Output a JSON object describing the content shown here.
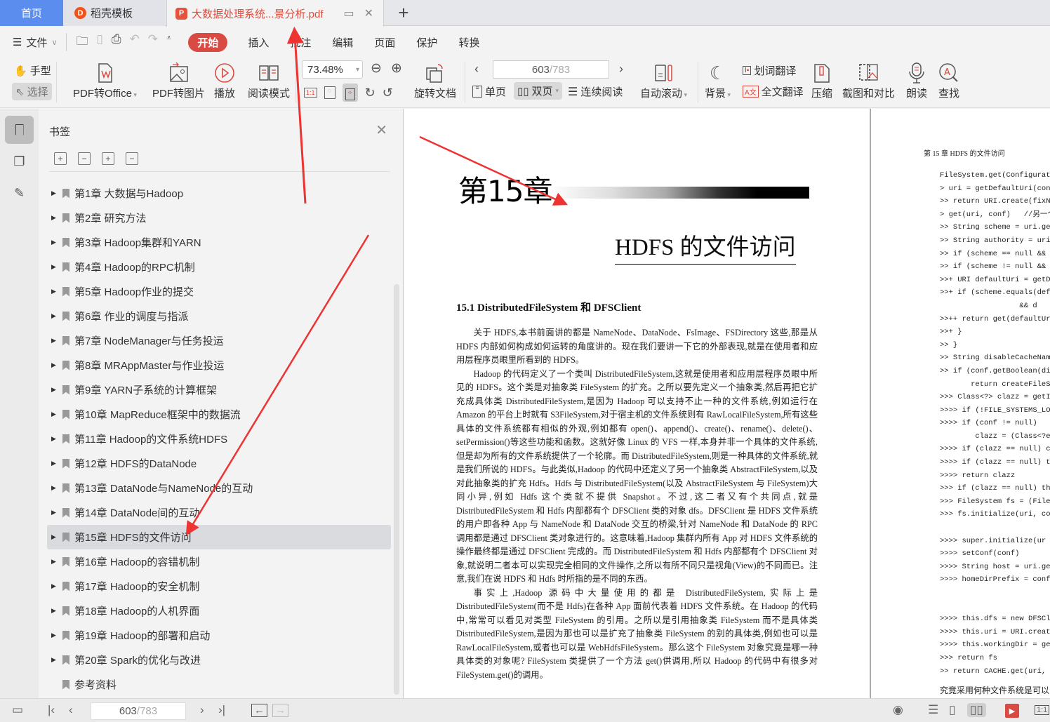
{
  "tabs": {
    "home": "首页",
    "template": "稻壳模板",
    "document": "大数据处理系统...景分析.pdf",
    "add": "+"
  },
  "menu": {
    "file": "文件",
    "items": [
      "开始",
      "插入",
      "批注",
      "编辑",
      "页面",
      "保护",
      "转换"
    ]
  },
  "toolbar": {
    "hand": "手型",
    "select": "选择",
    "pdf_to_office": "PDF转Office",
    "pdf_to_image": "PDF转图片",
    "play": "播放",
    "read_mode": "阅读模式",
    "zoom": "73.48%",
    "rotate_doc": "旋转文档",
    "page_current": "603",
    "page_total": "/783",
    "single": "单页",
    "double": "双页",
    "continuous": "连续阅读",
    "auto_scroll": "自动滚动",
    "background": "背景",
    "word_translate": "划词翻译",
    "full_translate": "全文翻译",
    "compress": "压缩",
    "screenshot_compare": "截图和对比",
    "read_aloud": "朗读",
    "find": "查找"
  },
  "bookmarks": {
    "title": "书签",
    "items": [
      {
        "label": "第1章  大数据与Hadoop",
        "expandable": true
      },
      {
        "label": "第2章  研究方法",
        "expandable": true
      },
      {
        "label": "第3章  Hadoop集群和YARN",
        "expandable": true
      },
      {
        "label": "第4章  Hadoop的RPC机制",
        "expandable": true
      },
      {
        "label": "第5章  Hadoop作业的提交",
        "expandable": true
      },
      {
        "label": "第6章  作业的调度与指派",
        "expandable": true
      },
      {
        "label": "第7章  NodeManager与任务投运",
        "expandable": true
      },
      {
        "label": "第8章  MRAppMaster与作业投运",
        "expandable": true
      },
      {
        "label": "第9章  YARN子系统的计算框架",
        "expandable": true
      },
      {
        "label": "第10章  MapReduce框架中的数据流",
        "expandable": true
      },
      {
        "label": "第11章  Hadoop的文件系统HDFS",
        "expandable": true
      },
      {
        "label": "第12章  HDFS的DataNode",
        "expandable": true
      },
      {
        "label": "第13章  DataNode与NameNode的互动",
        "expandable": true
      },
      {
        "label": "第14章  DataNode间的互动",
        "expandable": true
      },
      {
        "label": "第15章  HDFS的文件访问",
        "expandable": true,
        "active": true
      },
      {
        "label": "第16章  Hadoop的容错机制",
        "expandable": true
      },
      {
        "label": "第17章  Hadoop的安全机制",
        "expandable": true
      },
      {
        "label": "第18章  Hadoop的人机界面",
        "expandable": true
      },
      {
        "label": "第19章  Hadoop的部署和启动",
        "expandable": true
      },
      {
        "label": "第20章  Spark的优化与改进",
        "expandable": true
      },
      {
        "label": "参考资料",
        "expandable": false
      }
    ]
  },
  "page_left": {
    "chapter": "第15章",
    "title": "HDFS 的文件访问",
    "section": "15.1    DistributedFileSystem 和 DFSClient",
    "paragraphs": [
      "关于 HDFS,本书前面讲的都是 NameNode、DataNode、FsImage、FSDirectory 这些,那是从 HDFS 内部如何构成如何运转的角度讲的。现在我们要讲一下它的外部表现,就是在使用者和应用层程序员眼里所看到的 HDFS。",
      "Hadoop 的代码定义了一个类叫 DistributedFileSystem,这就是使用者和应用层程序员眼中所见的 HDFS。这个类是对抽象类 FileSystem 的扩充。之所以要先定义一个抽象类,然后再把它扩充成具体类 DistributedFileSystem,是因为 Hadoop 可以支持不止一种的文件系统,例如运行在 Amazon 的平台上时就有 S3FileSystem,对于宿主机的文件系统则有 RawLocalFileSystem,所有这些具体的文件系统都有相似的外观,例如都有 open()、append()、create()、rename()、delete()、setPermission()等这些功能和函数。这就好像 Linux 的 VFS 一样,本身并非一个具体的文件系统,但是却为所有的文件系统提供了一个轮廓。而 DistributedFileSystem,则是一种具体的文件系统,就是我们所说的 HDFS。与此类似,Hadoop 的代码中还定义了另一个抽象类 AbstractFileSystem,以及对此抽象类的扩充 Hdfs。Hdfs 与 DistributedFileSystem(以及 AbstractFileSystem 与 FileSystem)大同小异,例如 Hdfs 这个类就不提供 Snapshot。不过,这二者又有个共同点,就是 DistributedFileSystem 和 Hdfs 内部都有个 DFSClient 类的对象 dfs。DFSClient 是 HDFS 文件系统的用户即各种 App 与 NameNode 和 DataNode 交互的桥梁,针对 NameNode 和 DataNode 的 RPC 调用都是通过 DFSClient 类对象进行的。这意味着,Hadoop 集群内所有 App 对 HDFS 文件系统的操作最终都是通过 DFSClient 完成的。而 DistributedFileSystem 和 Hdfs 内部都有个 DFSClient 对象,就说明二者本可以实现完全相同的文件操作,之所以有所不同只是视角(View)的不同而已。注意,我们在说 HDFS 和 Hdfs 时所指的是不同的东西。",
      "事实上,Hadoop 源码中大量使用的都是 DistributedFileSystem,实际上是 DistributedFileSystem(而不是 Hdfs)在各种 App 面前代表着 HDFS 文件系统。在 Hadoop 的代码中,常常可以看见对类型 FileSystem 的引用。之所以是引用抽象类 FileSystem 而不是具体类 DistributedFileSystem,是因为那也可以是扩充了抽象类 FileSystem 的别的具体类,例如也可以是 RawLocalFileSystem,或者也可以是 WebHdfsFileSystem。那么这个 FileSystem 对象究竟是哪一种具体类的对象呢? FileSystem 类提供了一个方法 get()供调用,所以 Hadoop 的代码中有很多对 FileSystem.get()的调用。"
    ]
  },
  "page_right": {
    "header": "第 15 章    HDFS 的文件访问",
    "code_lines": [
      "FileSystem.get(Configuration",
      "> uri = getDefaultUri(conf)",
      ">> return URI.create(fixNa",
      "> get(uri, conf)   //另一个",
      ">> String scheme = uri.getS",
      ">> String authority = uri.g",
      ">> if (scheme == null && au",
      ">> if (scheme != null && aut",
      ">>+ URI defaultUri = getDe",
      ">>+ if (scheme.equals(def",
      "                  && d",
      ">>++ return get(defaultUr",
      ">>+ }",
      ">> }",
      ">> String disableCacheName",
      ">> if (conf.getBoolean(dis",
      "       return createFileSy",
      ">>> Class<?> clazz = getI",
      ">>>> if (!FILE_SYSTEMS_LO",
      ">>>> if (conf != null)",
      "        clazz = (Class<?ex",
      ">>>> if (clazz == null) cl",
      ">>>> if (clazz == null) th",
      ">>>> return clazz",
      ">>> if (clazz == null) throw",
      ">>> FileSystem fs = (FileSys",
      ">>> fs.initialize(uri, co",
      "",
      ">>>> super.initialize(ur",
      ">>>> setConf(conf)",
      ">>>> String host = uri.get",
      ">>>> homeDirPrefix = conf",
      "",
      "",
      ">>>> this.dfs = new DFSCl",
      ">>>> this.uri = URI.creat",
      ">>>> this.workingDir = ge",
      ">>> return fs",
      ">> return CACHE.get(uri, co"
    ],
    "footer": "究竟采用何种文件系统是可以"
  },
  "status": {
    "page_current": "603",
    "page_total": "/783"
  },
  "colors": {
    "accent_red": "#d84a42",
    "tab_home_blue": "#5b8def",
    "annotation_red": "#ee3333"
  }
}
